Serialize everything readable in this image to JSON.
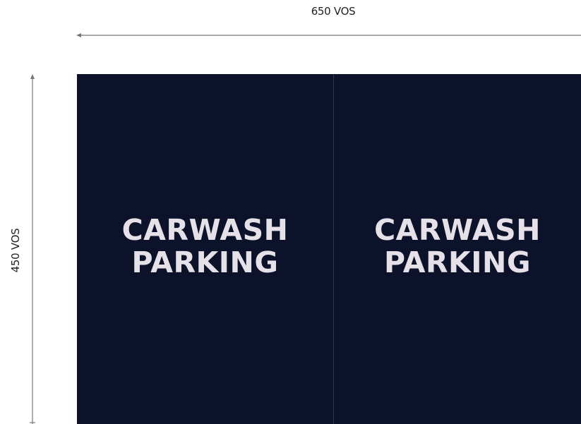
{
  "dimensions": {
    "width_label": "650 VOS",
    "height_label": "450 VOS"
  },
  "panels": [
    {
      "line1": "CARWASH",
      "line2": "PARKING"
    },
    {
      "line1": "CARWASH",
      "line2": "PARKING"
    }
  ],
  "colors": {
    "panel_background": "#0b1229",
    "sign_text": "#e6e1e8",
    "dimension_line": "#777777"
  }
}
